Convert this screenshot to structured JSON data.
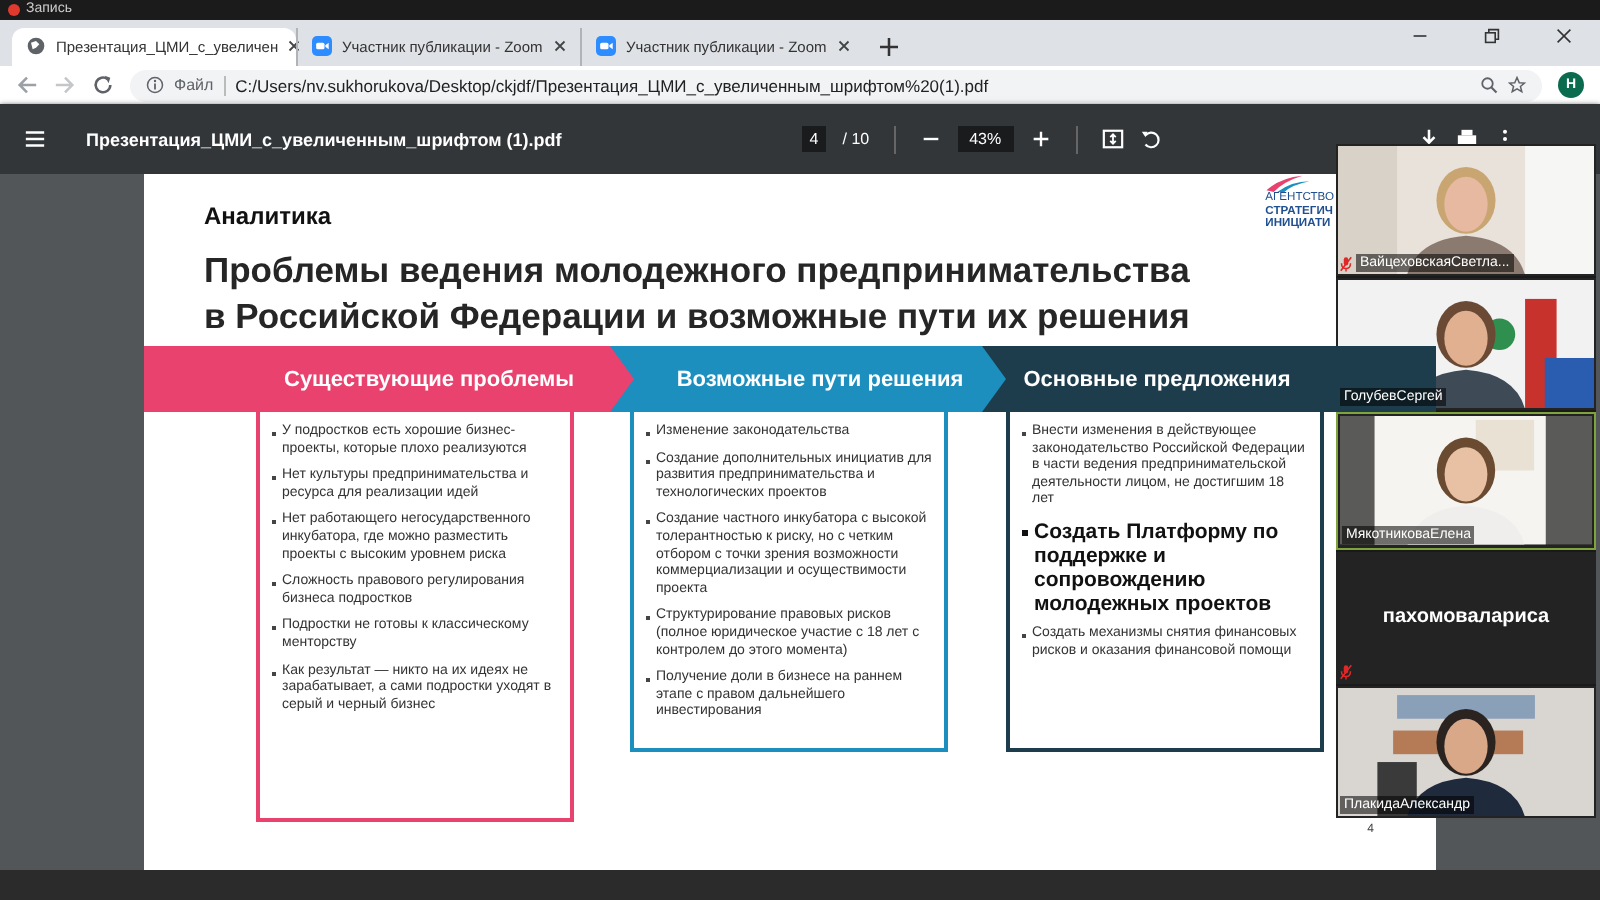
{
  "recording": {
    "label": "Запись"
  },
  "tabs": [
    {
      "title": "Презентация_ЦМИ_с_увеличен",
      "selected": true,
      "kind": "page"
    },
    {
      "title": "Участник публикации - Zoom",
      "selected": false,
      "kind": "zoom"
    },
    {
      "title": "Участник публикации - Zoom",
      "selected": false,
      "kind": "zoom"
    }
  ],
  "address_bar": {
    "scheme_label": "Файл",
    "url": "C:/Users/nv.sukhorukova/Desktop/ckjdf/Презентация_ЦМИ_с_увеличенным_шрифтом%20(1).pdf",
    "profile_initial": "Н"
  },
  "pdf_toolbar": {
    "filename": "Презентация_ЦМИ_с_увеличенным_шрифтом (1).pdf",
    "page": "4",
    "page_total": "/ 10",
    "zoom": "43%"
  },
  "slide": {
    "section": "Аналитика",
    "title_lines": [
      "Проблемы ведения молодежного предпринимательства",
      "в Российской Федерации и возможные пути их решения"
    ],
    "logo_lines": [
      "АГЕНТСТВО",
      "СТРАТЕГИЧ",
      "ИНИЦИАТИ"
    ],
    "columns": [
      {
        "heading": "Существующие проблемы",
        "color": "#e9426f",
        "items": [
          {
            "text": "У подростков есть хорошие бизнес-проекты, которые плохо реализуются",
            "kind": "normal"
          },
          {
            "text": "Нет культуры предпринимательства и ресурса для реализации идей",
            "kind": "normal"
          },
          {
            "text": "Нет работающего негосударственного инкубатора, где можно разместить проекты с высоким уровнем риска",
            "kind": "normal"
          },
          {
            "text": "Сложность правового регулирования бизнеса подростков",
            "kind": "normal"
          },
          {
            "text": "Подростки не готовы к классическому менторству",
            "kind": "normal"
          },
          {
            "text": "Как результат — никто на их идеях не зарабатывает, а сами подростки уходят в серый и черный бизнес",
            "kind": "normal"
          }
        ]
      },
      {
        "heading": "Возможные пути решения",
        "color": "#1c8fbf",
        "items": [
          {
            "text": "Изменение законодательства",
            "kind": "normal"
          },
          {
            "text": "Создание дополнительных инициатив для развития предпринимательства и технологических проектов",
            "kind": "normal"
          },
          {
            "text": "Создание частного инкубатора с высокой толерантностью к риску, но с четким отбором с точки зрения возможности коммерциализации и осуществимости проекта",
            "kind": "normal"
          },
          {
            "text": "Структурирование правовых рисков (полное юридическое участие с 18 лет с контролем до этого момента)",
            "kind": "normal"
          },
          {
            "text": "Получение доли в бизнесе на раннем этапе с правом дальнейшего инвестирования",
            "kind": "normal"
          }
        ]
      },
      {
        "heading": "Основные предложения",
        "color": "#1e3d4c",
        "items": [
          {
            "text": "Внести изменения в действующее законодательство Российской Федерации в части ведения предпринимательской деятельности лицом, не достигшим 18 лет",
            "kind": "normal"
          },
          {
            "text": "Создать Платформу по поддержке и сопровождению молодежных проектов",
            "kind": "emphasis"
          },
          {
            "text": "Создать механизмы снятия финансовых рисков и оказания финансовой помощи",
            "kind": "normal"
          }
        ]
      }
    ],
    "page_number": "4"
  },
  "participants": [
    {
      "name": "ВайцеховскаяСветла...",
      "muted": true,
      "speaking": false,
      "kind": "video"
    },
    {
      "name": "ГолубевСергей",
      "muted": false,
      "speaking": false,
      "kind": "video"
    },
    {
      "name": "МякотниковаЕлена",
      "muted": false,
      "speaking": true,
      "kind": "video"
    },
    {
      "name": "пахомоваларисa",
      "muted": true,
      "speaking": false,
      "kind": "name_only"
    },
    {
      "name": "ПлакидаАлександр",
      "muted": false,
      "speaking": false,
      "kind": "video"
    }
  ]
}
